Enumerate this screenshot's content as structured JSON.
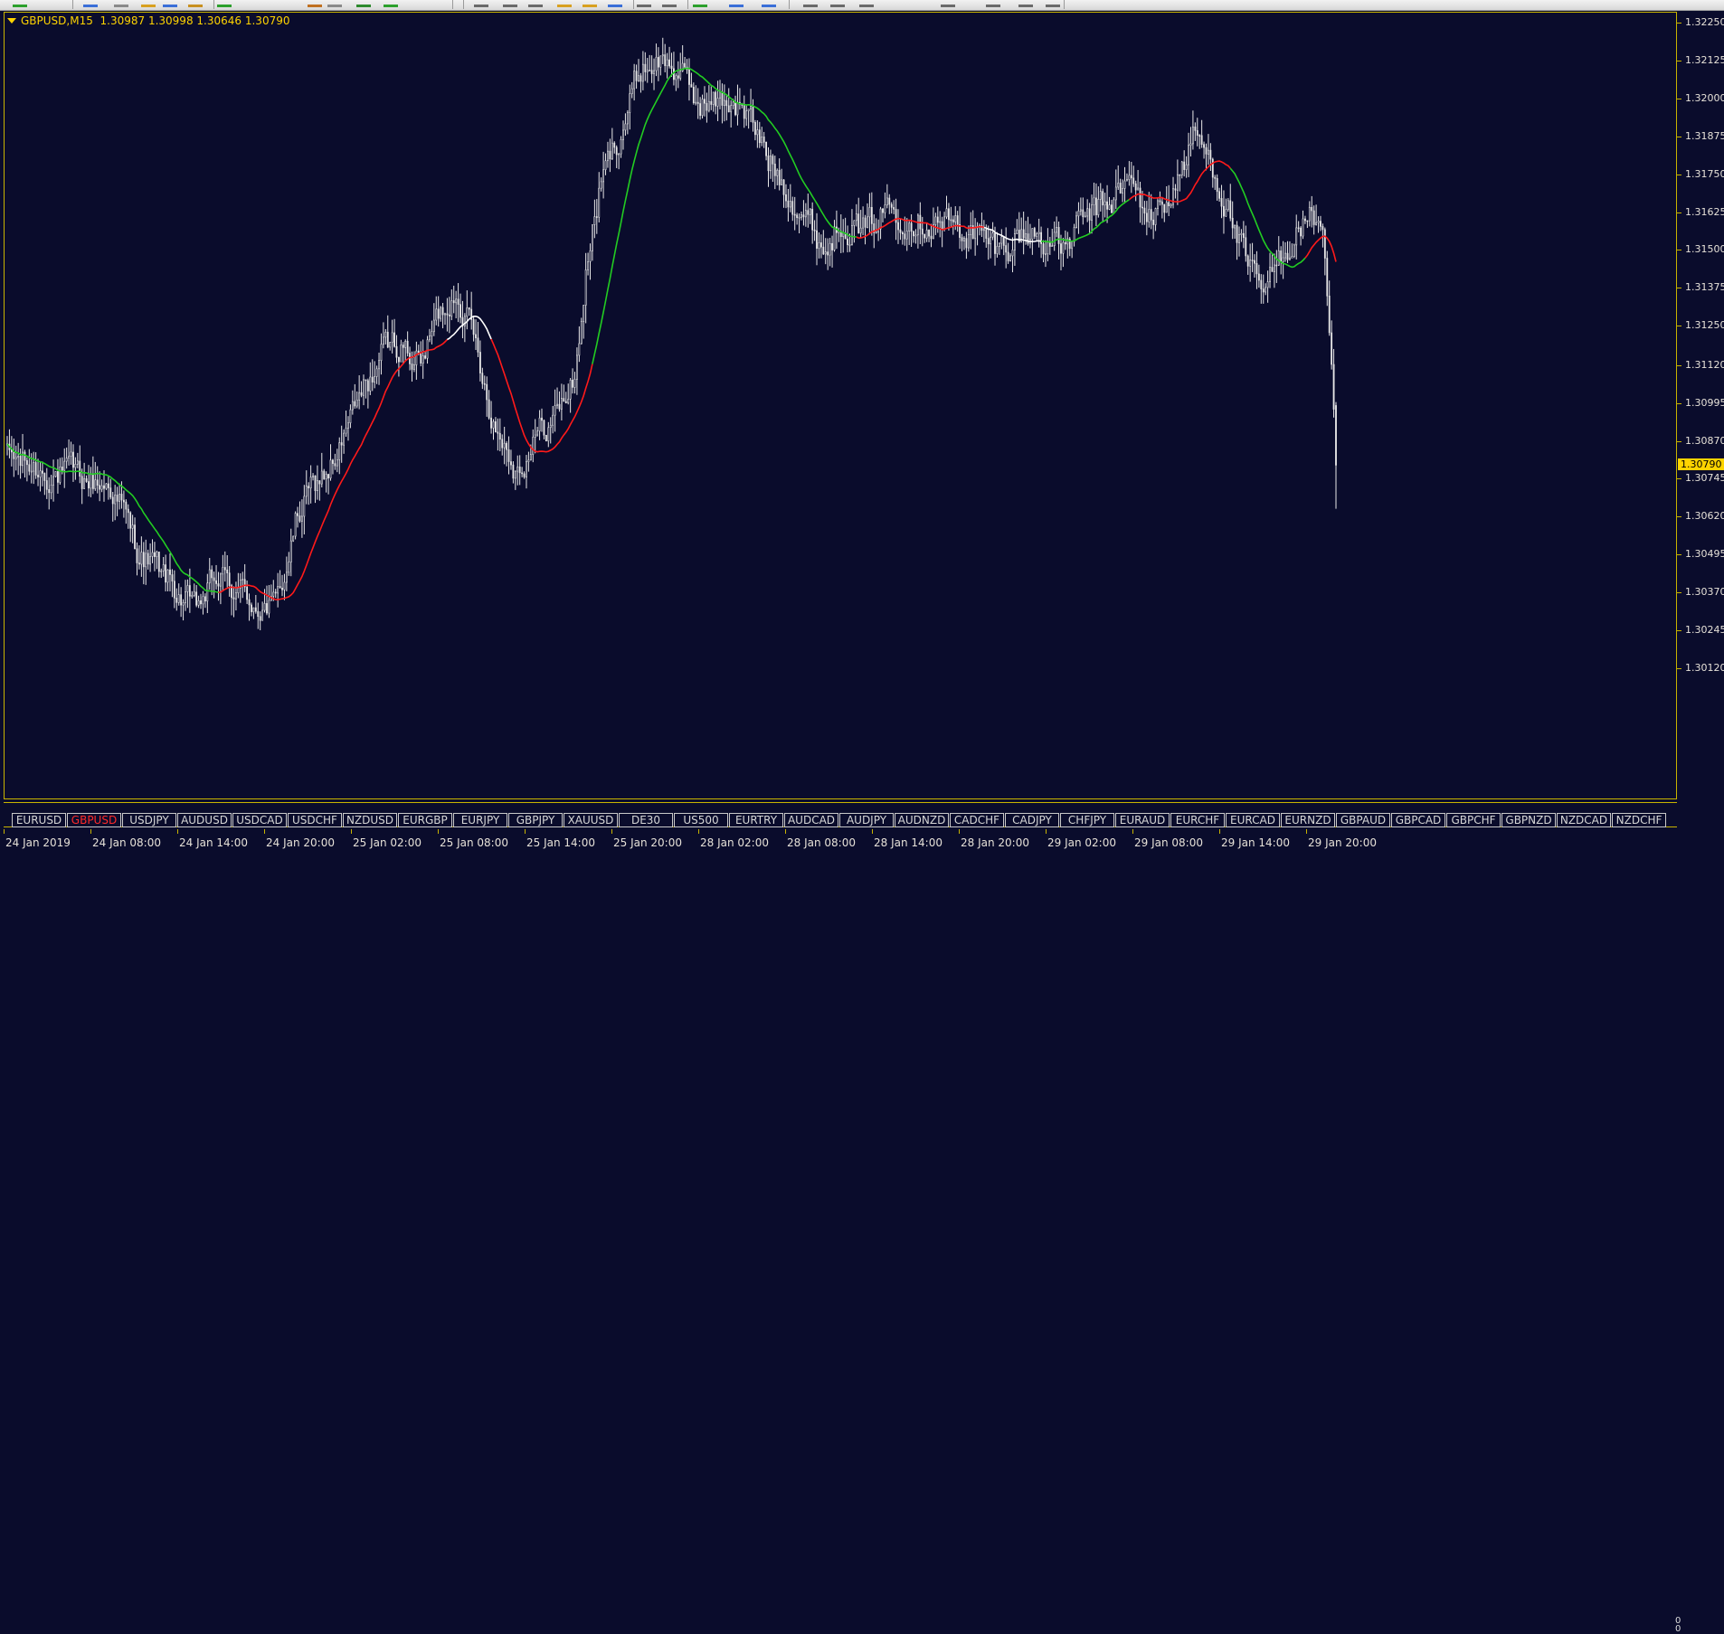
{
  "header": {
    "symbol": "GBPUSD,M15",
    "open": "1.30987",
    "high": "1.30998",
    "low": "1.30646",
    "close": "1.30790"
  },
  "colors": {
    "background": "#0a0c2c",
    "grid_accent": "#c8b400",
    "candle": "#e8e8e8",
    "ma_up": "#22cc22",
    "ma_down": "#ff1a1a",
    "ma_flat": "#ffffff",
    "current_price_bg": "#ffd400"
  },
  "price_axis": {
    "labels": [
      "1.32250",
      "1.32125",
      "1.32000",
      "1.31875",
      "1.31750",
      "1.31625",
      "1.31500",
      "1.31375",
      "1.31250",
      "1.31120",
      "1.30995",
      "1.30870",
      "1.30745",
      "1.30620",
      "1.30495",
      "1.30370",
      "1.30245",
      "1.30120"
    ],
    "current_price": "1.30790"
  },
  "time_axis": {
    "labels": [
      "24 Jan 2019",
      "24 Jan 08:00",
      "24 Jan 14:00",
      "24 Jan 20:00",
      "25 Jan 02:00",
      "25 Jan 08:00",
      "25 Jan 14:00",
      "25 Jan 20:00",
      "28 Jan 02:00",
      "28 Jan 08:00",
      "28 Jan 14:00",
      "28 Jan 20:00",
      "29 Jan 02:00",
      "29 Jan 08:00",
      "29 Jan 14:00",
      "29 Jan 20:00"
    ]
  },
  "symbol_tabs": {
    "items": [
      "EURUSD",
      "GBPUSD",
      "USDJPY",
      "AUDUSD",
      "USDCAD",
      "USDCHF",
      "NZDUSD",
      "EURGBP",
      "EURJPY",
      "GBPJPY",
      "XAUUSD",
      "DE30",
      "US500",
      "EURTRY",
      "AUDCAD",
      "AUDJPY",
      "AUDNZD",
      "CADCHF",
      "CADJPY",
      "CHFJPY",
      "EURAUD",
      "EURCHF",
      "EURCAD",
      "EURNZD",
      "GBPAUD",
      "GBPCAD",
      "GBPCHF",
      "GBPNZD",
      "NZDCAD",
      "NZDCHF"
    ],
    "active": "GBPUSD",
    "scroll_up": "0",
    "scroll_down": "0"
  },
  "chart_data": {
    "type": "candlestick",
    "symbol": "GBPUSD",
    "timeframe": "M15",
    "ylim": [
      1.3008,
      1.3232
    ],
    "close_anchors": [
      [
        0,
        1.3082
      ],
      [
        12,
        1.3078
      ],
      [
        30,
        1.3075
      ],
      [
        48,
        1.3072
      ],
      [
        60,
        1.305
      ],
      [
        72,
        1.3042
      ],
      [
        85,
        1.303
      ],
      [
        95,
        1.3042
      ],
      [
        110,
        1.3035
      ],
      [
        122,
        1.3031
      ],
      [
        132,
        1.3062
      ],
      [
        140,
        1.3072
      ],
      [
        150,
        1.3082
      ],
      [
        160,
        1.31
      ],
      [
        170,
        1.3115
      ],
      [
        178,
        1.312
      ],
      [
        188,
        1.3112
      ],
      [
        196,
        1.3128
      ],
      [
        205,
        1.3138
      ],
      [
        214,
        1.3116
      ],
      [
        222,
        1.3092
      ],
      [
        232,
        1.3078
      ],
      [
        240,
        1.3088
      ],
      [
        250,
        1.3096
      ],
      [
        258,
        1.3108
      ],
      [
        264,
        1.3148
      ],
      [
        270,
        1.3172
      ],
      [
        278,
        1.3188
      ],
      [
        288,
        1.321
      ],
      [
        296,
        1.3213
      ],
      [
        304,
        1.321
      ],
      [
        312,
        1.32
      ],
      [
        322,
        1.3198
      ],
      [
        330,
        1.32
      ],
      [
        338,
        1.3192
      ],
      [
        346,
        1.318
      ],
      [
        354,
        1.3172
      ],
      [
        362,
        1.3162
      ],
      [
        372,
        1.315
      ],
      [
        380,
        1.3162
      ],
      [
        390,
        1.3155
      ],
      [
        400,
        1.3165
      ],
      [
        410,
        1.3162
      ],
      [
        420,
        1.316
      ],
      [
        430,
        1.3158
      ],
      [
        440,
        1.3155
      ],
      [
        450,
        1.315
      ],
      [
        460,
        1.3155
      ],
      [
        470,
        1.3155
      ],
      [
        480,
        1.315
      ],
      [
        490,
        1.316
      ],
      [
        500,
        1.3165
      ],
      [
        510,
        1.3172
      ],
      [
        520,
        1.316
      ],
      [
        530,
        1.317
      ],
      [
        540,
        1.3188
      ],
      [
        548,
        1.3178
      ],
      [
        556,
        1.3162
      ],
      [
        564,
        1.3142
      ],
      [
        572,
        1.3135
      ],
      [
        580,
        1.315
      ],
      [
        590,
        1.316
      ],
      [
        598,
        1.316
      ],
      [
        604,
        1.3079
      ]
    ],
    "ma_segments": [
      {
        "trend": "up",
        "from": 0,
        "to": 96
      },
      {
        "trend": "down",
        "from": 96,
        "to": 200
      },
      {
        "trend": "flat",
        "from": 200,
        "to": 220
      },
      {
        "trend": "down",
        "from": 220,
        "to": 266
      },
      {
        "trend": "up",
        "from": 266,
        "to": 386
      },
      {
        "trend": "down",
        "from": 386,
        "to": 444
      },
      {
        "trend": "flat",
        "from": 444,
        "to": 470
      },
      {
        "trend": "up",
        "from": 470,
        "to": 510
      },
      {
        "trend": "down",
        "from": 510,
        "to": 556
      },
      {
        "trend": "up",
        "from": 556,
        "to": 590
      },
      {
        "trend": "down",
        "from": 590,
        "to": 604
      }
    ],
    "last_bar": {
      "open": 1.30987,
      "high": 1.30998,
      "low": 1.30646,
      "close": 1.3079
    }
  }
}
